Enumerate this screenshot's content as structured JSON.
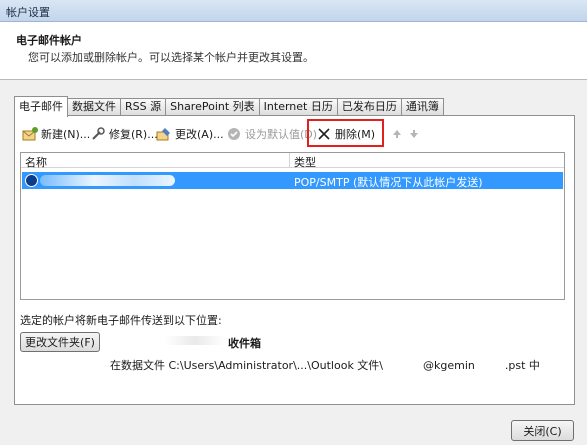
{
  "window": {
    "title": "帐户设置"
  },
  "header": {
    "title": "电子邮件帐户",
    "subtitle": "您可以添加或删除帐户。可以选择某个帐户并更改其设置。"
  },
  "tabs": [
    {
      "label": "电子邮件",
      "active": true
    },
    {
      "label": "数据文件"
    },
    {
      "label": "RSS 源"
    },
    {
      "label": "SharePoint 列表"
    },
    {
      "label": "Internet 日历"
    },
    {
      "label": "已发布日历"
    },
    {
      "label": "通讯簿"
    }
  ],
  "toolbar": {
    "new_label": "新建(N)...",
    "repair_label": "修复(R)...",
    "change_label": "更改(A)...",
    "set_default_label": "设为默认值(D)",
    "remove_label": "删除(M)"
  },
  "list": {
    "columns": {
      "name": "名称",
      "type": "类型"
    },
    "rows": [
      {
        "type": "POP/SMTP (默认情况下从此帐户发送)"
      }
    ]
  },
  "delivery": {
    "label": "选定的帐户将新电子邮件传送到以下位置:",
    "change_folder_label": "更改文件夹(F)",
    "inbox_label": "收件箱",
    "path_prefix": "在数据文件 C:\\Users\\Administrator\\...\\Outlook 文件\\",
    "path_mid": "@kgemin",
    "path_suffix": ".pst 中"
  },
  "footer": {
    "close_label": "关闭(C)"
  },
  "colors": {
    "selection": "#3399ff",
    "highlight_box": "#e0211d",
    "title_bar": "#c2d5ec"
  }
}
